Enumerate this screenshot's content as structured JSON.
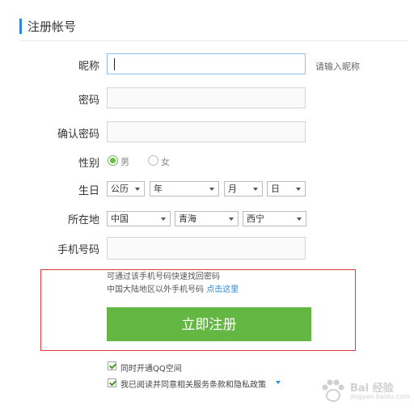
{
  "header": {
    "title": "注册帐号"
  },
  "form": {
    "nickname": {
      "label": "昵称",
      "value": "",
      "hint": "请输入昵称"
    },
    "password": {
      "label": "密码",
      "value": ""
    },
    "confirm_password": {
      "label": "确认密码",
      "value": ""
    },
    "gender": {
      "label": "性别",
      "options": [
        "男",
        "女"
      ],
      "selected": "男"
    },
    "birthday": {
      "label": "生日",
      "calendar": "公历",
      "year": "年",
      "month": "月",
      "day": "日"
    },
    "location": {
      "label": "所在地",
      "country": "中国",
      "province": "青海",
      "city": "西宁"
    },
    "phone": {
      "label": "手机号码",
      "value": ""
    }
  },
  "notes": {
    "line1": "可通过该手机号码快速找回密码",
    "line2": "中国大陆地区以外手机号码",
    "link": "点击这里"
  },
  "submit_label": "立即注册",
  "checkboxes": {
    "qzone": {
      "label": "同时开通QQ空间",
      "checked": true
    },
    "terms": {
      "label": "我已阅读并同意相关服务条款和隐私政策",
      "checked": true
    }
  },
  "watermark": {
    "text": "Bai 经验",
    "url": "jingyan.baidu.com"
  },
  "colors": {
    "accent": "#2a8ad9",
    "button": "#65b744",
    "highlight_box": "#e03a3a"
  }
}
